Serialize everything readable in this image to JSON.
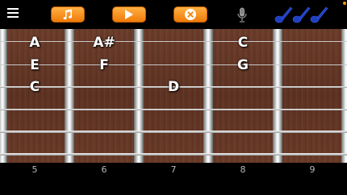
{
  "toolbar": {
    "menu_icon": "hamburger-menu-icon",
    "buttons": [
      "music-note-icon",
      "play-icon",
      "close-circle-icon"
    ],
    "mic_icon": "microphone-icon",
    "instruments_icon": "guitars-icon",
    "accent_color": "#f39014"
  },
  "fretboard": {
    "notes": [
      {
        "label": "A",
        "string": 1,
        "fret": "5"
      },
      {
        "label": "A#",
        "string": 1,
        "fret": "6"
      },
      {
        "label": "C",
        "string": 1,
        "fret": "8"
      },
      {
        "label": "E",
        "string": 2,
        "fret": "5"
      },
      {
        "label": "F",
        "string": 2,
        "fret": "6"
      },
      {
        "label": "G",
        "string": 2,
        "fret": "8"
      },
      {
        "label": "C",
        "string": 3,
        "fret": "5"
      },
      {
        "label": "D",
        "string": 3,
        "fret": "7"
      }
    ],
    "fret_numbers": [
      "5",
      "6",
      "7",
      "8",
      "9"
    ],
    "wood_color": "#5f3424"
  }
}
